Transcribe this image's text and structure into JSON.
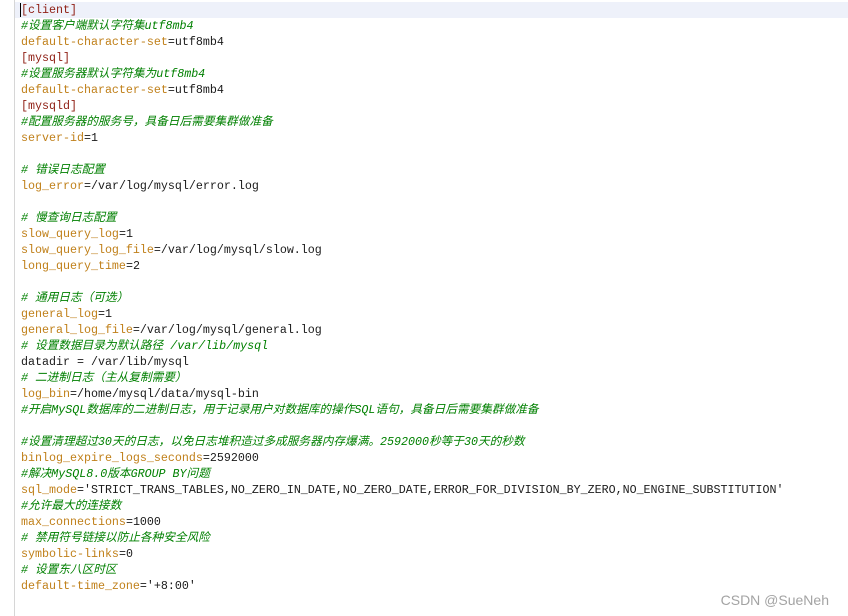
{
  "editor": {
    "lines": [
      {
        "section": "[client]"
      },
      {
        "comment": "#设置客户端默认字符集utf8mb4"
      },
      {
        "key": "default-character-set",
        "assign": "=",
        "value": "utf8mb4"
      },
      {
        "section": "[mysql]"
      },
      {
        "comment": "#设置服务器默认字符集为utf8mb4"
      },
      {
        "key": "default-character-set",
        "assign": "=",
        "value": "utf8mb4"
      },
      {
        "section": "[mysqld]"
      },
      {
        "comment": "#配置服务器的服务号，具备日后需要集群做准备"
      },
      {
        "key": "server-id",
        "assign": "=",
        "value": "1"
      },
      {},
      {
        "comment": "# 错误日志配置"
      },
      {
        "key": "log_error",
        "assign": "=",
        "value": "/var/log/mysql/error.log"
      },
      {},
      {
        "comment": "# 慢查询日志配置"
      },
      {
        "key": "slow_query_log",
        "assign": "=",
        "value": "1"
      },
      {
        "key": "slow_query_log_file",
        "assign": "=",
        "value": "/var/log/mysql/slow.log"
      },
      {
        "key": "long_query_time",
        "assign": "=",
        "value": "2"
      },
      {},
      {
        "comment": "# 通用日志（可选）"
      },
      {
        "key": "general_log",
        "assign": "=",
        "value": "1"
      },
      {
        "key": "general_log_file",
        "assign": "=",
        "value": "/var/log/mysql/general.log"
      },
      {
        "comment": "# 设置数据目录为默认路径 /var/lib/mysql"
      },
      {
        "plain": "datadir = /var/lib/mysql"
      },
      {
        "comment": "# 二进制日志（主从复制需要）"
      },
      {
        "key": "log_bin",
        "assign": "=",
        "value": "/home/mysql/data/mysql-bin"
      },
      {
        "comment": "#开启MySQL数据库的二进制日志，用于记录用户对数据库的操作SQL语句，具备日后需要集群做准备"
      },
      {},
      {
        "comment": "#设置清理超过30天的日志，以免日志堆积造过多成服务器内存爆满。2592000秒等于30天的秒数"
      },
      {
        "key": "binlog_expire_logs_seconds",
        "assign": "=",
        "value": "2592000"
      },
      {
        "comment": "#解决MySQL8.0版本GROUP BY问题"
      },
      {
        "key": "sql_mode",
        "assign": "=",
        "value": "'STRICT_TRANS_TABLES,NO_ZERO_IN_DATE,NO_ZERO_DATE,ERROR_FOR_DIVISION_BY_ZERO,NO_ENGINE_SUBSTITUTION'"
      },
      {
        "comment": "#允许最大的连接数"
      },
      {
        "key": "max_connections",
        "assign": "=",
        "value": "1000"
      },
      {
        "comment": "# 禁用符号链接以防止各种安全风险"
      },
      {
        "key": "symbolic-links",
        "assign": "=",
        "value": "0"
      },
      {
        "comment": "# 设置东八区时区"
      },
      {
        "key": "default-time_zone",
        "assign": "=",
        "value": "'+8:00'"
      }
    ]
  },
  "syntax_colors": {
    "section": "#8f1f14",
    "comment": "#008000",
    "key": "#c0801a",
    "value": "#1a1a1a",
    "background": "#ffffff",
    "current_line": "#eef1fa",
    "watermark": "#a3a3a3"
  },
  "watermark": "CSDN @SueNeh"
}
